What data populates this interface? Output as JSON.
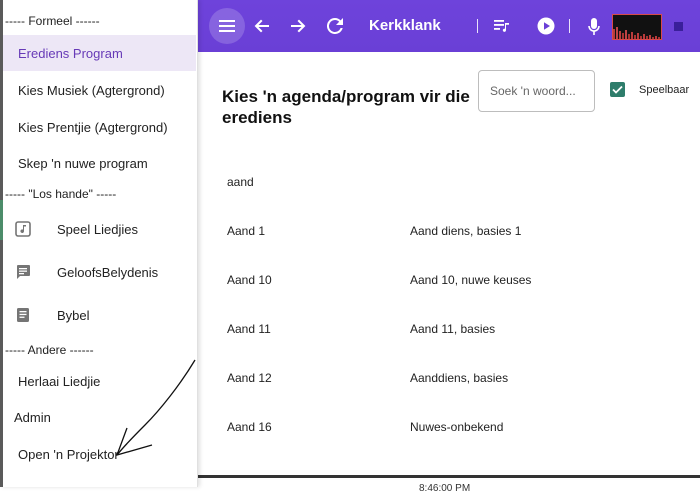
{
  "sidebar": {
    "sep_formeel": "----- Formeel ------",
    "items_formeel": [
      {
        "label": "Erediens Program",
        "active": true
      },
      {
        "label": "Kies Musiek (Agtergrond)"
      },
      {
        "label": "Kies Prentjie (Agtergrond)"
      },
      {
        "label": "Skep 'n nuwe program"
      }
    ],
    "sep_los": "----- \"Los hande\" -----",
    "items_los": [
      {
        "label": "Speel Liedjies",
        "icon": "music-note-icon"
      },
      {
        "label": "GeloofsBelydenis",
        "icon": "creed-list-icon"
      },
      {
        "label": "Bybel",
        "icon": "book-icon"
      }
    ],
    "sep_andere": "----- Andere ------",
    "items_andere": [
      {
        "label": "Herlaai Liedjie"
      },
      {
        "label": "Admin"
      },
      {
        "label": "Open 'n Projektor"
      }
    ]
  },
  "topbar": {
    "title": "Kerkklank",
    "colors": {
      "bar": "#6a3fd6",
      "meter_border": "#d84a4a"
    }
  },
  "main": {
    "title": "Kies 'n agenda/program vir die erediens",
    "search_placeholder": "Soek 'n woord...",
    "playable_label": "Speelbaar",
    "playable_checked": true,
    "rows": [
      {
        "name": "aand",
        "desc": ""
      },
      {
        "name": "Aand 1",
        "desc": "Aand diens, basies 1"
      },
      {
        "name": "Aand 10",
        "desc": "Aand 10, nuwe keuses"
      },
      {
        "name": "Aand 11",
        "desc": "Aand 11, basies"
      },
      {
        "name": "Aand 12",
        "desc": "Aanddiens, basies"
      },
      {
        "name": "Aand 16",
        "desc": "Nuwes-onbekend"
      }
    ],
    "bottom_text": "8:46:00 PM"
  }
}
